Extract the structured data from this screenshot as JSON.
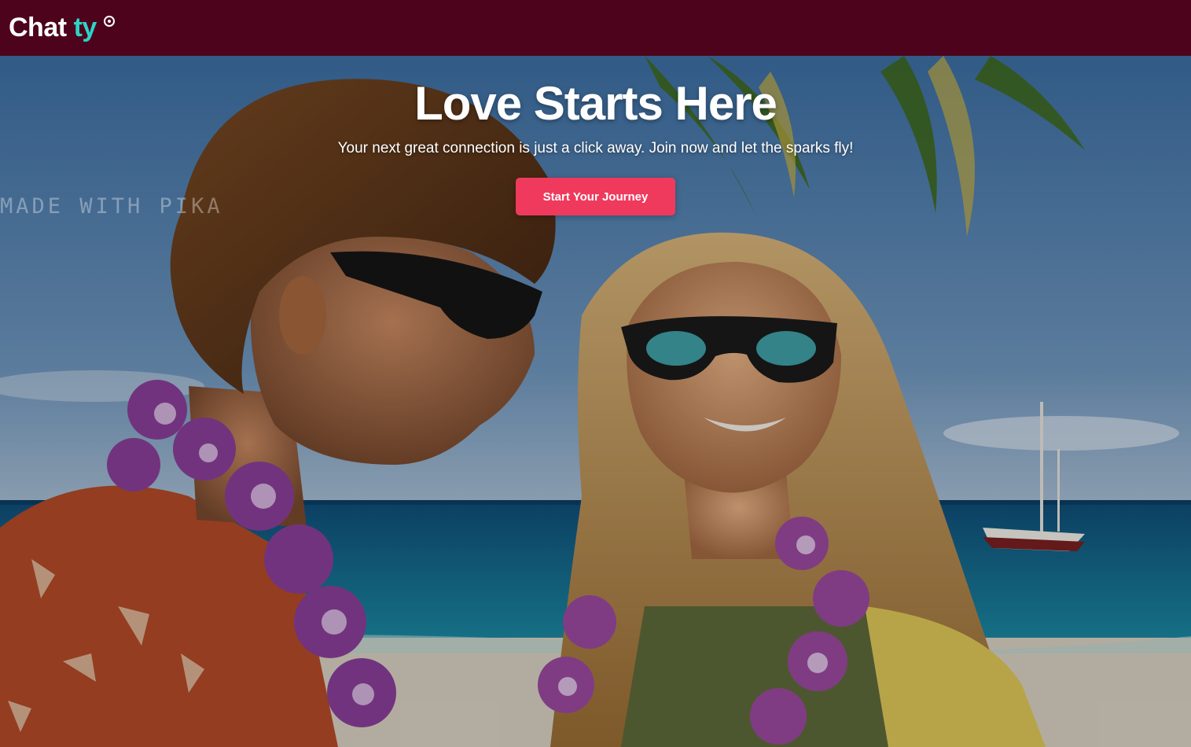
{
  "brand": {
    "part1": "Chat",
    "part2": "ty",
    "accent": "#2ed3c8"
  },
  "colors": {
    "navbar": "#4d031b",
    "cta": "#ef3a5d"
  },
  "hero": {
    "title": "Love Starts Here",
    "subtitle": "Your next great connection is just a click away. Join now and let the sparks fly!",
    "cta_label": "Start Your Journey",
    "watermark": "MADE WITH PIKA",
    "image": "beach-couple-photo"
  },
  "icons": {
    "registered": "registered-mark-icon"
  }
}
